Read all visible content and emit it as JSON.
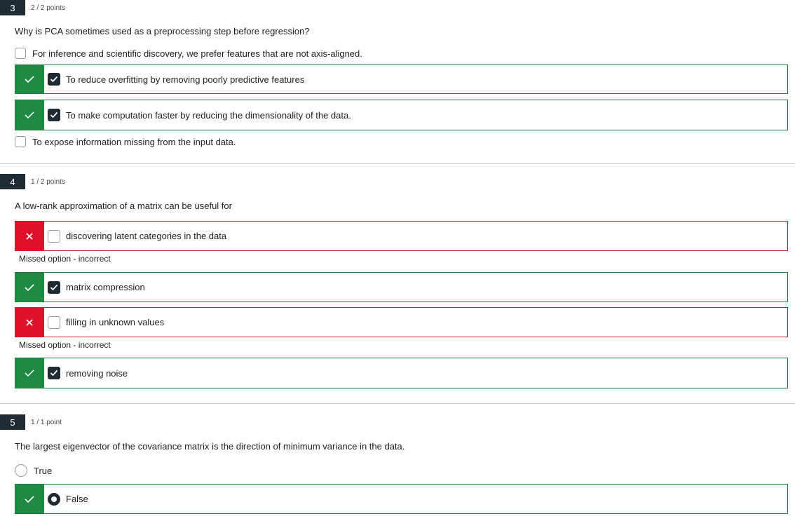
{
  "q3": {
    "number": "3",
    "points": "2 / 2 points",
    "question": "Why is PCA sometimes used as a preprocessing step before regression?",
    "options": [
      {
        "label": "For inference and scientific discovery, we prefer features that are not axis-aligned.",
        "selected": false,
        "status": "none"
      },
      {
        "label": "To reduce overfitting by removing poorly predictive features",
        "selected": true,
        "status": "correct"
      },
      {
        "label": "To make computation faster by reducing the dimensionality of the data.",
        "selected": true,
        "status": "correct"
      },
      {
        "label": "To expose information missing from the input data.",
        "selected": false,
        "status": "none"
      }
    ]
  },
  "q4": {
    "number": "4",
    "points": "1 / 2 points",
    "question": "A low-rank approximation of a matrix can be useful for",
    "options": [
      {
        "label": "discovering latent categories in the data",
        "selected": false,
        "status": "incorrect",
        "feedback": "Missed option - incorrect"
      },
      {
        "label": "matrix compression",
        "selected": true,
        "status": "correct"
      },
      {
        "label": "filling in unknown values",
        "selected": false,
        "status": "incorrect",
        "feedback": "Missed option - incorrect"
      },
      {
        "label": "removing noise",
        "selected": true,
        "status": "correct"
      }
    ]
  },
  "q5": {
    "number": "5",
    "points": "1 / 1 point",
    "question": "The largest eigenvector of the covariance matrix is the direction of minimum variance in the data.",
    "options": [
      {
        "label": "True",
        "selected": false,
        "status": "none"
      },
      {
        "label": "False",
        "selected": true,
        "status": "correct"
      }
    ]
  },
  "icons": {
    "correct": "check-icon",
    "incorrect": "x-icon",
    "checkbox_checked": "checkmark-icon"
  },
  "colors": {
    "correct": "#1e8a44",
    "incorrect": "#e0112b",
    "dark": "#1f2a33"
  }
}
